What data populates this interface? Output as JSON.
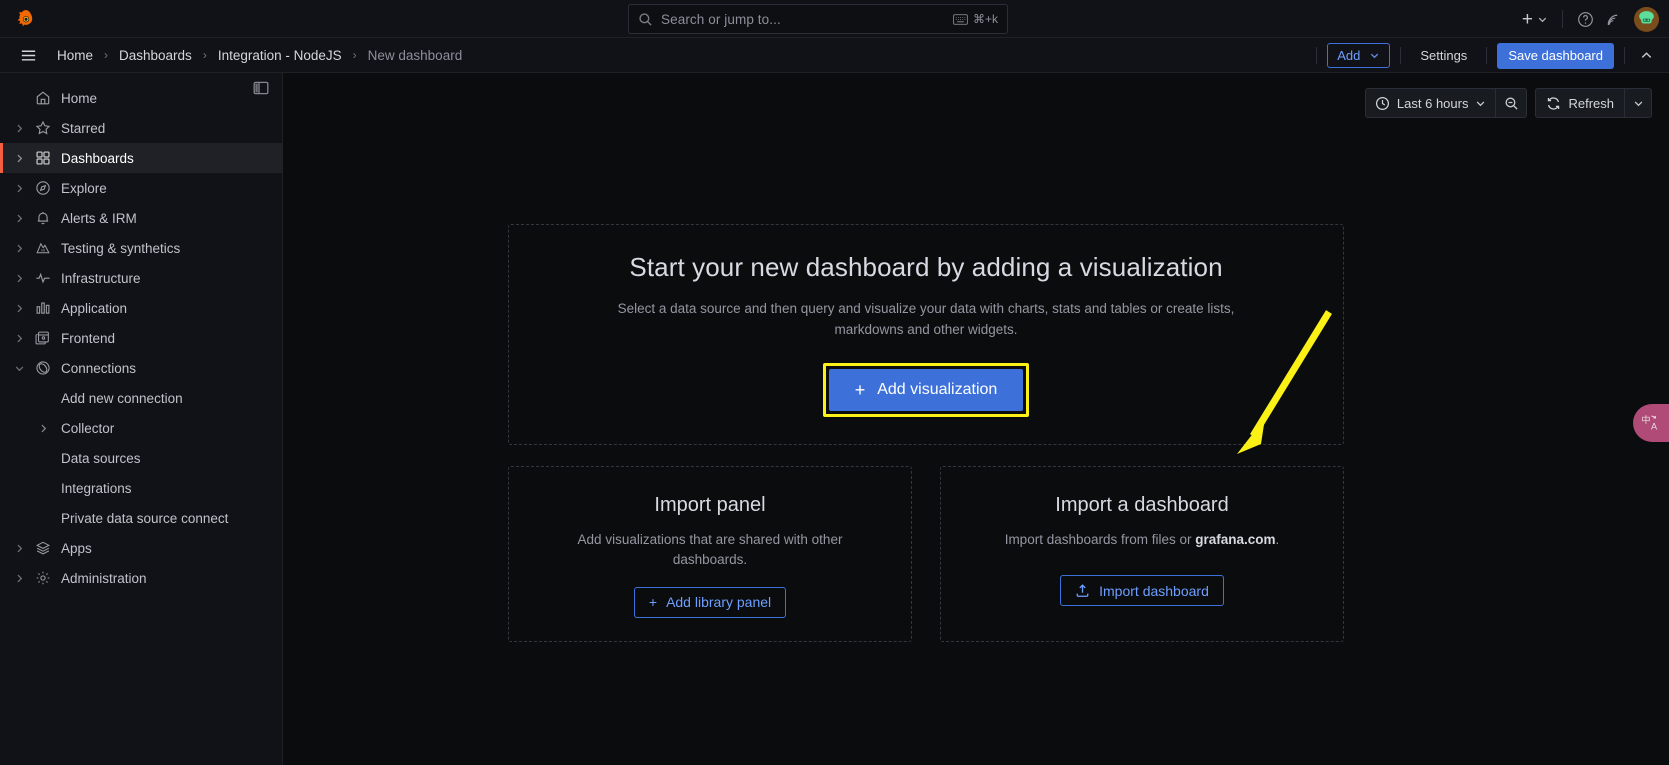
{
  "topbar": {
    "logo_icon": "grafana-logo-icon",
    "search": {
      "placeholder": "Search or jump to...",
      "icon": "search-icon",
      "shortcut": "⌘+k",
      "keyboard_icon": "keyboard-icon"
    },
    "new_icon": "plus-icon",
    "new_caret_icon": "chevron-down-icon",
    "help_icon": "help-circle-icon",
    "news_icon": "rss-icon",
    "avatar_icon": "user-avatar-icon"
  },
  "breadcrumb": {
    "menu_icon": "hamburger-menu-icon",
    "items": [
      {
        "label": "Home",
        "current": false
      },
      {
        "label": "Dashboards",
        "current": false
      },
      {
        "label": "Integration - NodeJS",
        "current": false
      },
      {
        "label": "New dashboard",
        "current": true
      }
    ],
    "separator": "›",
    "actions": {
      "add_label": "Add",
      "add_caret_icon": "chevron-down-icon",
      "settings_label": "Settings",
      "save_label": "Save dashboard",
      "collapse_icon": "chevron-up-icon"
    }
  },
  "sidebar": {
    "dock_icon": "dock-panel-icon",
    "items": [
      {
        "label": "Home",
        "icon": "home-icon",
        "caret": false,
        "active": false,
        "child": false
      },
      {
        "label": "Starred",
        "icon": "star-icon",
        "caret": true,
        "active": false,
        "child": false
      },
      {
        "label": "Dashboards",
        "icon": "dashboards-grid-icon",
        "caret": true,
        "active": true,
        "child": false
      },
      {
        "label": "Explore",
        "icon": "compass-icon",
        "caret": true,
        "active": false,
        "child": false
      },
      {
        "label": "Alerts & IRM",
        "icon": "bell-icon",
        "caret": true,
        "active": false,
        "child": false
      },
      {
        "label": "Testing & synthetics",
        "icon": "k6-mountain-icon",
        "caret": true,
        "active": false,
        "child": false
      },
      {
        "label": "Infrastructure",
        "icon": "heartbeat-pulse-icon",
        "caret": true,
        "active": false,
        "child": false
      },
      {
        "label": "Application",
        "icon": "bar-chart-icon",
        "caret": true,
        "active": false,
        "child": false
      },
      {
        "label": "Frontend",
        "icon": "browser-window-icon",
        "caret": true,
        "active": false,
        "child": false
      },
      {
        "label": "Connections",
        "icon": "connections-rings-icon",
        "caret": true,
        "caret_open": true,
        "active": false,
        "child": false
      },
      {
        "label": "Add new connection",
        "icon": "",
        "caret": false,
        "active": false,
        "child": true
      },
      {
        "label": "Collector",
        "icon": "",
        "caret": true,
        "active": false,
        "child": true
      },
      {
        "label": "Data sources",
        "icon": "",
        "caret": false,
        "active": false,
        "child": true
      },
      {
        "label": "Integrations",
        "icon": "",
        "caret": false,
        "active": false,
        "child": true
      },
      {
        "label": "Private data source connect",
        "icon": "",
        "caret": false,
        "active": false,
        "child": true
      },
      {
        "label": "Apps",
        "icon": "layers-icon",
        "caret": true,
        "active": false,
        "child": false
      },
      {
        "label": "Administration",
        "icon": "gear-icon",
        "caret": true,
        "active": false,
        "child": false
      }
    ]
  },
  "toolbar": {
    "time_range": "Last 6 hours",
    "time_icon": "clock-icon",
    "time_caret_icon": "chevron-down-icon",
    "zoom_out_icon": "zoom-out-icon",
    "refresh_label": "Refresh",
    "refresh_icon": "refresh-sync-icon",
    "refresh_caret_icon": "chevron-down-icon"
  },
  "hero": {
    "title": "Start your new dashboard by adding a visualization",
    "subtitle": "Select a data source and then query and visualize your data with charts, stats and tables or create lists, markdowns and other widgets.",
    "button_label": "Add visualization",
    "button_plus": "+",
    "highlight_color": "#fbf117",
    "button_color": "#3d71d9"
  },
  "cards": [
    {
      "title": "Import panel",
      "subtitle": "Add visualizations that are shared with other dashboards.",
      "button_label": "Add library panel",
      "button_plus": "+",
      "button_icon": ""
    },
    {
      "title": "Import a dashboard",
      "subtitle_prefix": "Import dashboards from files or ",
      "subtitle_link": "grafana.com",
      "subtitle_suffix": ".",
      "button_label": "Import dashboard",
      "button_icon": "upload-icon"
    }
  ],
  "annotation": {
    "arrow_color": "#fbf117",
    "type": "pointer-arrow"
  },
  "translate_widget": {
    "label": "中A",
    "icon": "translate-icon",
    "color": "#b04a77"
  }
}
